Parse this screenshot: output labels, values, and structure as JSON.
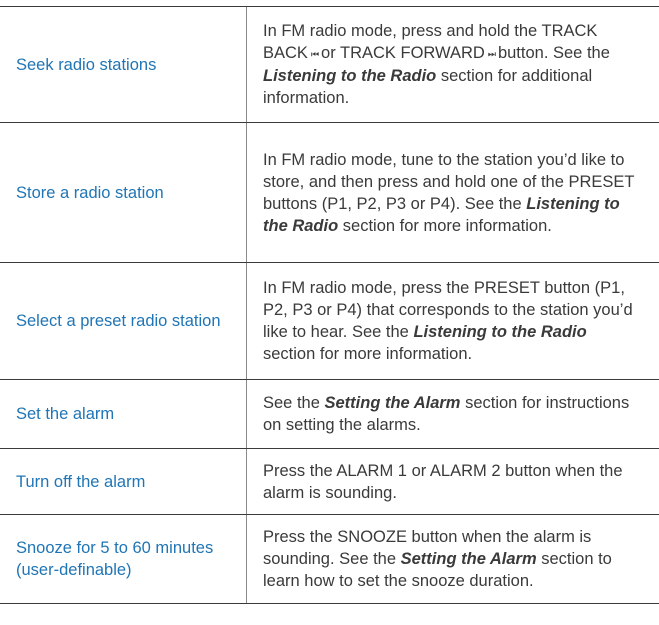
{
  "rows": [
    {
      "task": "Seek radio stations",
      "desc": {
        "a": "In FM radio mode, press and hold the TRACK BACK",
        "glyph_back": "⏮",
        "b": "or TRACK FORWARD",
        "glyph_fwd": "⏭",
        "c": "button. See the",
        "em": "Listening to the Radio",
        "d": "section for additional information."
      }
    },
    {
      "task": "Store a radio station",
      "desc": {
        "a": "In FM radio mode, tune to the station you’d like to store, and then press and hold one of the PRESET buttons (P1, P2, P3 or P4). See the",
        "em": "Listening to the Radio",
        "b": "section for more information."
      }
    },
    {
      "task": "Select a preset radio station",
      "desc": {
        "a": "In FM radio mode, press the PRESET button (P1, P2, P3 or P4) that corresponds to the station you’d like to hear. See the",
        "em": "Listening to the Radio",
        "b": "section for more information."
      }
    },
    {
      "task": "Set the alarm",
      "desc": {
        "a": "See the",
        "em": "Setting the Alarm",
        "b": "section for instructions on setting the alarms."
      }
    },
    {
      "task": "Turn off the alarm",
      "desc": {
        "a": "Press the ALARM 1 or ALARM 2 button when the alarm is sounding."
      }
    },
    {
      "task": "Snooze for 5 to 60 minutes (user-definable)",
      "desc": {
        "a": "Press the SNOOZE button when the alarm is sounding. See the",
        "em": "Setting the Alarm",
        "b": "section to learn how to set the snooze duration."
      }
    }
  ]
}
